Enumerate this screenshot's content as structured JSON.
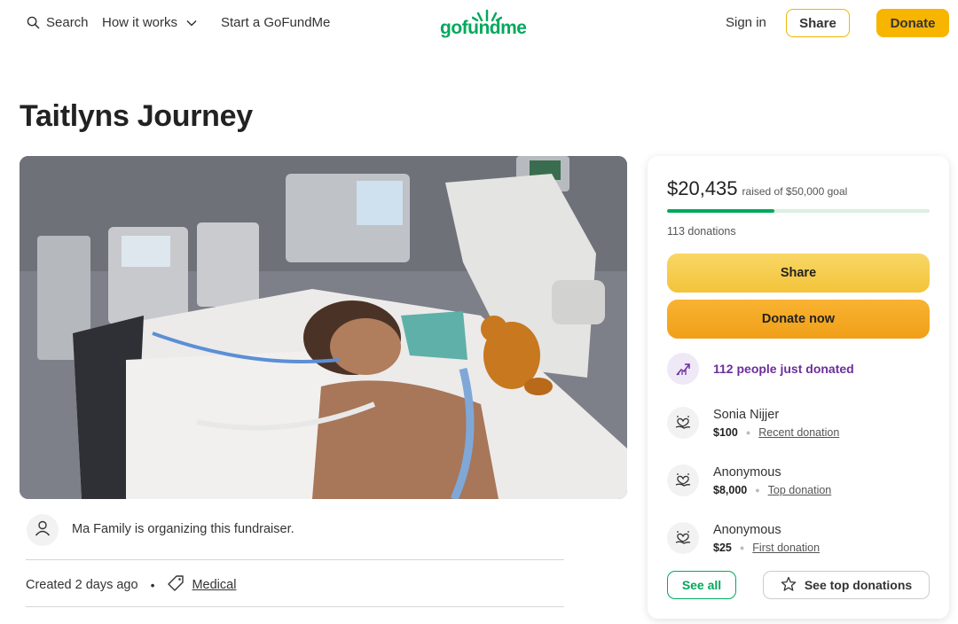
{
  "header": {
    "search_label": "Search",
    "how_it_works_label": "How it works",
    "start_label": "Start a GoFundMe",
    "logo_text": "gofundme",
    "signin_label": "Sign in",
    "share_label": "Share",
    "donate_label": "Donate"
  },
  "campaign": {
    "title": "Taitlyns Journey",
    "organizer_text": "Ma Family is organizing this fundraiser.",
    "created_text": "Created 2 days ago",
    "meta_separator": "•",
    "category": "Medical"
  },
  "donation_card": {
    "raised_amount": "$20,435",
    "raised_goal_text": "raised of $50,000 goal",
    "progress_fraction": 0.41,
    "donation_count": "113 donations",
    "share_button": "Share",
    "donate_button": "Donate now",
    "trend_text": "112 people just donated",
    "donors": [
      {
        "name": "Sonia Nijjer",
        "amount": "$100",
        "tag": "Recent donation"
      },
      {
        "name": "Anonymous",
        "amount": "$8,000",
        "tag": "Top donation"
      },
      {
        "name": "Anonymous",
        "amount": "$25",
        "tag": "First donation"
      }
    ],
    "see_all_button": "See all",
    "see_top_button": "See top donations"
  },
  "colors": {
    "brand_green": "#02a95c",
    "donate_orange": "#f0a018",
    "share_yellow": "#f3c33a",
    "trend_purple": "#6b2e9b"
  },
  "icons": {
    "search": "search-icon",
    "chevron": "chevron-down-icon",
    "organizer": "user-icon",
    "category": "tag-icon",
    "trend": "trending-up-icon",
    "donor": "heart-hand-icon",
    "star": "star-icon"
  }
}
